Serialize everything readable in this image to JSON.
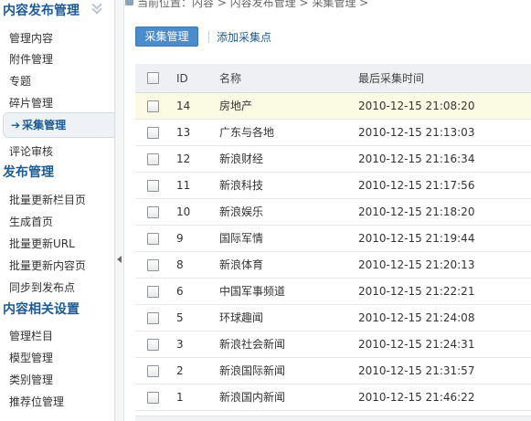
{
  "sidebar": {
    "sections": [
      {
        "title": "内容发布管理",
        "items": [
          "管理内容",
          "附件管理",
          "专题",
          "碎片管理",
          "采集管理",
          "评论审核"
        ]
      },
      {
        "title": "发布管理",
        "items": [
          "批量更新栏目页",
          "生成首页",
          "批量更新URL",
          "批量更新内容页",
          "同步到发布点"
        ]
      },
      {
        "title": "内容相关设置",
        "items": [
          "管理栏目",
          "模型管理",
          "类别管理",
          "推荐位管理"
        ]
      }
    ],
    "active_item": "采集管理"
  },
  "breadcrumb": "当前位置：内容 > 内容发布管理 > 采集管理 >",
  "tabs": {
    "active": "采集管理",
    "link": "添加采集点"
  },
  "table": {
    "headers": [
      "ID",
      "名称",
      "最后采集时间"
    ],
    "rows": [
      {
        "id": "14",
        "name": "房地产",
        "time": "2010-12-15 21:08:20"
      },
      {
        "id": "13",
        "name": "广东与各地",
        "time": "2010-12-15 21:13:03"
      },
      {
        "id": "12",
        "name": "新浪财经",
        "time": "2010-12-15 21:16:34"
      },
      {
        "id": "11",
        "name": "新浪科技",
        "time": "2010-12-15 21:17:56"
      },
      {
        "id": "10",
        "name": "新浪娱乐",
        "time": "2010-12-15 21:18:20"
      },
      {
        "id": "9",
        "name": "国际军情",
        "time": "2010-12-15 21:19:44"
      },
      {
        "id": "8",
        "name": "新浪体育",
        "time": "2010-12-15 21:20:13"
      },
      {
        "id": "6",
        "name": "中国军事频道",
        "time": "2010-12-15 21:22:21"
      },
      {
        "id": "5",
        "name": "环球趣闻",
        "time": "2010-12-15 21:24:08"
      },
      {
        "id": "3",
        "name": "新浪社会新闻",
        "time": "2010-12-15 21:24:31"
      },
      {
        "id": "2",
        "name": "新浪国际新闻",
        "time": "2010-12-15 21:31:57"
      },
      {
        "id": "1",
        "name": "新浪国内新闻",
        "time": "2010-12-15 21:46:22"
      }
    ]
  },
  "colors": {
    "accent": "#4a8ccc",
    "heading": "#1d5a93",
    "highlight_row": "#fbfbe3"
  }
}
